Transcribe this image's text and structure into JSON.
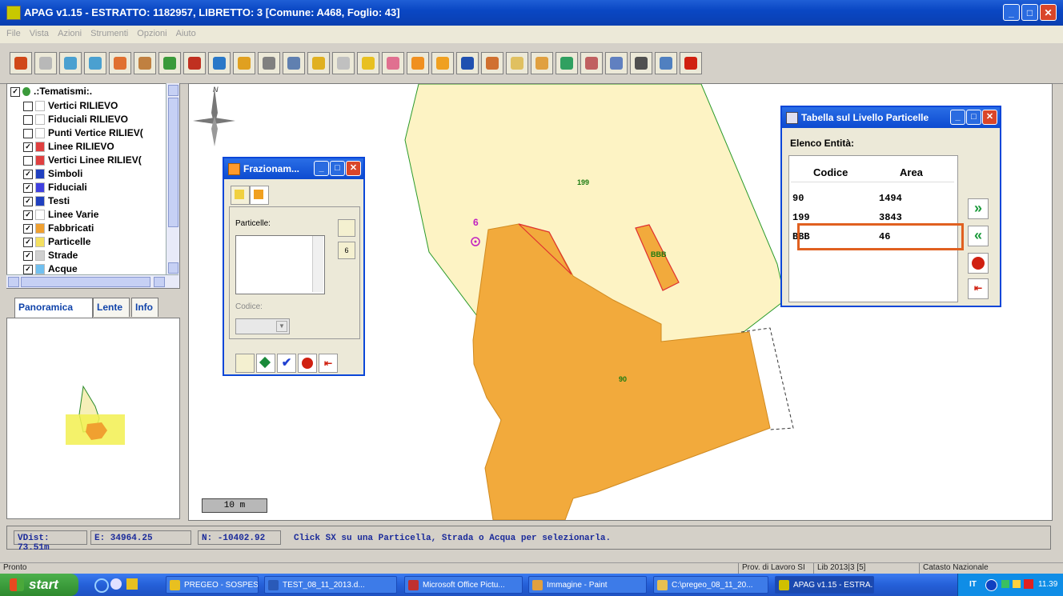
{
  "window": {
    "title": "APAG v1.15 - ESTRATTO: 1182957, LIBRETTO: 3 [Comune: A468, Foglio: 43]",
    "min": "_",
    "max": "□",
    "close": "✕"
  },
  "menu": [
    "File",
    "Vista",
    "Azioni",
    "Strumenti",
    "Opzioni",
    "Aiuto"
  ],
  "toolbar": {
    "tools": [
      {
        "name": "zoom-in-icon",
        "color": "#d04818"
      },
      {
        "name": "zoom-window-icon",
        "color": "#b8b8b8"
      },
      {
        "name": "zoom-plus-icon",
        "color": "#4aa0d0"
      },
      {
        "name": "zoom-minus-icon",
        "color": "#4aa0d0"
      },
      {
        "name": "zoom-extent-icon",
        "color": "#e07030"
      },
      {
        "name": "pan-icon",
        "color": "#c08040"
      },
      {
        "name": "zoom-all-icon",
        "color": "#3a9a3a"
      },
      {
        "name": "zoom-previous-icon",
        "color": "#c03020"
      },
      {
        "name": "globe-icon",
        "color": "#2a78c8"
      },
      {
        "name": "measure-icon",
        "color": "#e0a020"
      },
      {
        "name": "info-icon",
        "color": "#808080"
      },
      {
        "name": "link-icon",
        "color": "#6080b0"
      },
      {
        "name": "select-icon",
        "color": "#e0b020"
      },
      {
        "name": "table-icon",
        "color": "#c0c0c0"
      },
      {
        "name": "layers-icon",
        "color": "#e8c020"
      },
      {
        "name": "split-icon",
        "color": "#e07090"
      },
      {
        "name": "particle-icon",
        "color": "#f09020"
      },
      {
        "name": "edit-icon",
        "color": "#f0a020"
      },
      {
        "name": "save-icon",
        "color": "#2050b0"
      },
      {
        "name": "chart-icon",
        "color": "#d07030"
      },
      {
        "name": "page-icon",
        "color": "#e0c060"
      },
      {
        "name": "pencil-icon",
        "color": "#e0a040"
      },
      {
        "name": "flag-icon",
        "color": "#30a060"
      },
      {
        "name": "grid-icon",
        "color": "#c06060"
      },
      {
        "name": "document-icon",
        "color": "#6080c0"
      },
      {
        "name": "print-icon",
        "color": "#505050"
      },
      {
        "name": "help-icon",
        "color": "#5080c0"
      },
      {
        "name": "power-icon",
        "color": "#d02010"
      }
    ]
  },
  "tree": {
    "root": ".:Tematismi:.",
    "items": [
      {
        "label": "Vertici RILIEVO",
        "checked": "",
        "swatch": "#ffffff"
      },
      {
        "label": "Fiduciali RILIEVO",
        "checked": "",
        "swatch": "#ffffff"
      },
      {
        "label": "Punti Vertice RILIEV(",
        "checked": "",
        "swatch": "#ffffff"
      },
      {
        "label": "Linee RILIEVO",
        "checked": "✓",
        "swatch": "#e04040"
      },
      {
        "label": "Vertici Linee RILIEV(",
        "checked": "",
        "swatch": "#e04040"
      },
      {
        "label": "Simboli",
        "checked": "✓",
        "swatch": "#2040c0"
      },
      {
        "label": "Fiduciali",
        "checked": "✓",
        "swatch": "#4040e0"
      },
      {
        "label": "Testi",
        "checked": "✓",
        "swatch": "#2040c0"
      },
      {
        "label": "Linee Varie",
        "checked": "✓",
        "swatch": "#ffffff"
      },
      {
        "label": "Fabbricati",
        "checked": "✓",
        "swatch": "#f0a030"
      },
      {
        "label": "Particelle",
        "checked": "✓",
        "swatch": "#f4e060"
      },
      {
        "label": "Strade",
        "checked": "✓",
        "swatch": "#d0d0d0"
      },
      {
        "label": "Acque",
        "checked": "✓",
        "swatch": "#70c0f0"
      }
    ]
  },
  "tabs": {
    "panoramica": "Panoramica",
    "lente": "Lente",
    "info": "Info"
  },
  "map": {
    "north": "N",
    "labels": {
      "p199": "199",
      "p90": "90",
      "bbb": "BBB",
      "fiducial": "6"
    },
    "scale": "10 m"
  },
  "fraz": {
    "title": "Frazionam...",
    "particelle_label": "Particelle:",
    "codice_label": "Codice:",
    "side_btn2": "6"
  },
  "tabella": {
    "title": "Tabella sul Livello Particelle",
    "elenco": "Elenco Entità:",
    "col_codice": "Codice",
    "col_area": "Area",
    "rows": [
      {
        "codice": "90",
        "area": "1494"
      },
      {
        "codice": "199",
        "area": "3843"
      },
      {
        "codice": "BBB",
        "area": "46"
      }
    ],
    "highlight_color": "#e06020"
  },
  "status": {
    "vdist": "VDist: 73.51m",
    "e": "E: 34964.25",
    "n": "N: -10402.92",
    "message": "Click SX su una Particella, Strada o Acqua per selezionarla."
  },
  "bottom": {
    "pronto": "Pronto",
    "prov": "Prov. di Lavoro SI",
    "lib": "Lib 2013|3 [5]",
    "catasto": "Catasto Nazionale"
  },
  "taskbar": {
    "start": "start",
    "tasks": [
      {
        "label": "PREGEO - SOSPESO I...",
        "color": "#e8c020"
      },
      {
        "label": "TEST_08_11_2013.d...",
        "color": "#2a5ab8"
      },
      {
        "label": "Microsoft Office Pictu...",
        "color": "#c03030"
      },
      {
        "label": "Immagine - Paint",
        "color": "#e0a040"
      },
      {
        "label": "C:\\pregeo_08_11_20...",
        "color": "#e8c050"
      },
      {
        "label": "APAG v1.15 - ESTRA...",
        "color": "#d0c000"
      }
    ],
    "lang": "IT",
    "clock": "11.39"
  }
}
